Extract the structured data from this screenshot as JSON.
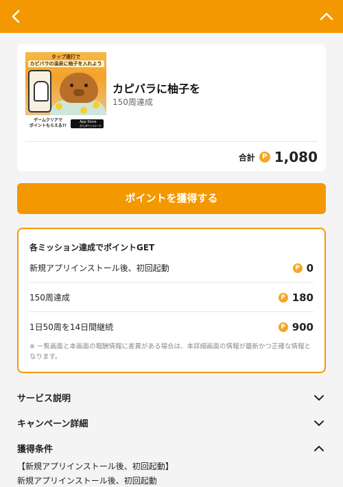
{
  "header": {
    "back_icon": "chevron-left-icon",
    "collapse_icon": "chevron-up-icon",
    "color": "#f39800"
  },
  "app": {
    "thumb_text_line1": "タップ連打で",
    "thumb_text_line2": "カピバラの温泉に柚子を入れよう",
    "thumb_bottom_text": "ゲームクリアで\nポイントもらえる?!",
    "store_badge_line1": "App Store",
    "store_badge_line2": "からダウンロード",
    "title": "カピバラに柚子を",
    "subtitle": "150周達成",
    "total_label": "合計",
    "coin_symbol": "P",
    "total_points": "1,080"
  },
  "cta": {
    "label": "ポイントを獲得する",
    "color": "#f39800"
  },
  "missions": {
    "title": "各ミッション達成でポイントGET",
    "items": [
      {
        "label": "新規アプリインストール後、初回起動",
        "points": "0"
      },
      {
        "label": "150周達成",
        "points": "180"
      },
      {
        "label": "1日50周を14日間継続",
        "points": "900"
      }
    ],
    "note": "※ 一覧画面と本画面の報酬情報に差異がある場合は、本詳細画面の情報が最新かつ正確な情報となります。"
  },
  "sections": {
    "service": {
      "title": "サービス説明",
      "icon": "chevron-down-icon"
    },
    "campaign": {
      "title": "キャンペーン詳細",
      "icon": "chevron-down-icon"
    },
    "conditions": {
      "title": "獲得条件",
      "icon": "chevron-up-icon",
      "line1": "【新規アプリインストール後、初回起動】",
      "line2": "新規アプリインストール後、初回起動"
    }
  }
}
